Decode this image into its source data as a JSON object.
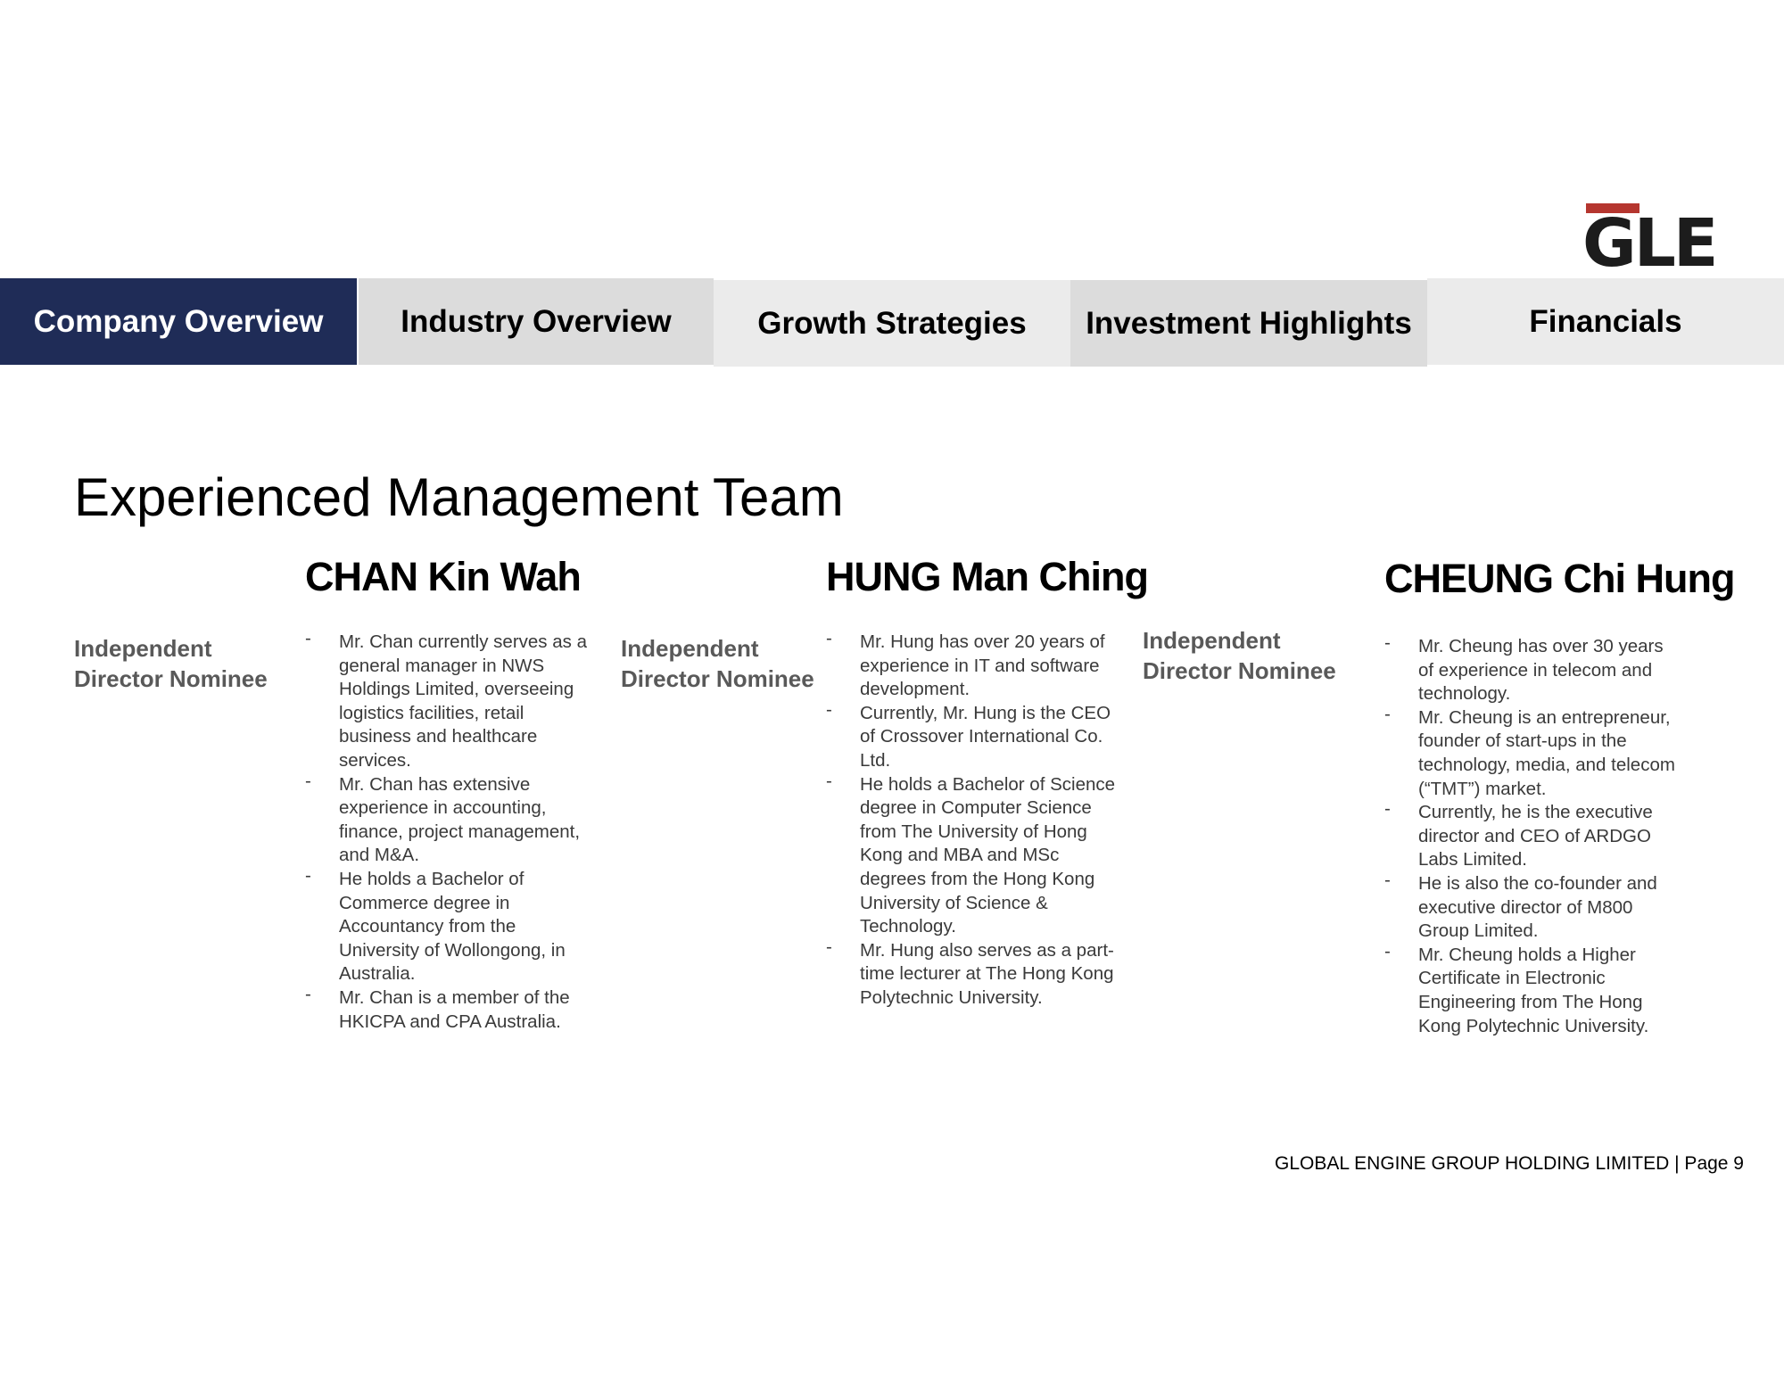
{
  "logo": {
    "text": "GLE",
    "accent_color": "#b5362f"
  },
  "nav": {
    "tabs": [
      {
        "label": "Company Overview",
        "active": true
      },
      {
        "label": "Industry Overview",
        "active": false
      },
      {
        "label": "Growth Strategies",
        "active": false
      },
      {
        "label": "Investment Highlights",
        "active": false
      },
      {
        "label": "Financials",
        "active": false
      }
    ],
    "active_color": "#1f2c57"
  },
  "page": {
    "title": "Experienced Management Team"
  },
  "people": [
    {
      "role": "Independent Director Nominee",
      "name": "CHAN Kin Wah",
      "bio": [
        "Mr. Chan currently serves as a general manager in NWS Holdings Limited, overseeing logistics facilities, retail business and healthcare services.",
        "Mr. Chan has extensive experience in accounting, finance, project management, and M&A.",
        "He holds a Bachelor of Commerce degree in Accountancy from the University of Wollongong, in Australia.",
        "Mr. Chan is a member of the HKICPA and CPA Australia."
      ]
    },
    {
      "role": "Independent Director Nominee",
      "name": "HUNG Man Ching",
      "bio": [
        "Mr. Hung has over 20 years of experience in IT and software development.",
        "Currently, Mr. Hung is the CEO of Crossover International Co. Ltd.",
        "He holds a Bachelor of Science degree in Computer Science from The University of Hong Kong and MBA and MSc degrees from the Hong Kong University of Science & Technology.",
        "Mr. Hung also serves as a part-time lecturer at The Hong Kong Polytechnic University."
      ]
    },
    {
      "role": "Independent Director Nominee",
      "name": "CHEUNG Chi Hung",
      "bio": [
        "Mr. Cheung has over 30 years of experience in telecom and technology.",
        "Mr. Cheung is an entrepreneur, founder of start-ups in the technology, media, and telecom (“TMT”) market.",
        "Currently, he is the executive director and CEO of ARDGO Labs Limited.",
        "He is also the co-founder and executive director of M800 Group Limited.",
        "Mr. Cheung holds a Higher Certificate in Electronic Engineering from The Hong Kong Polytechnic University."
      ]
    }
  ],
  "footer": {
    "text": "GLOBAL ENGINE GROUP HOLDING LIMITED | Page 9"
  }
}
